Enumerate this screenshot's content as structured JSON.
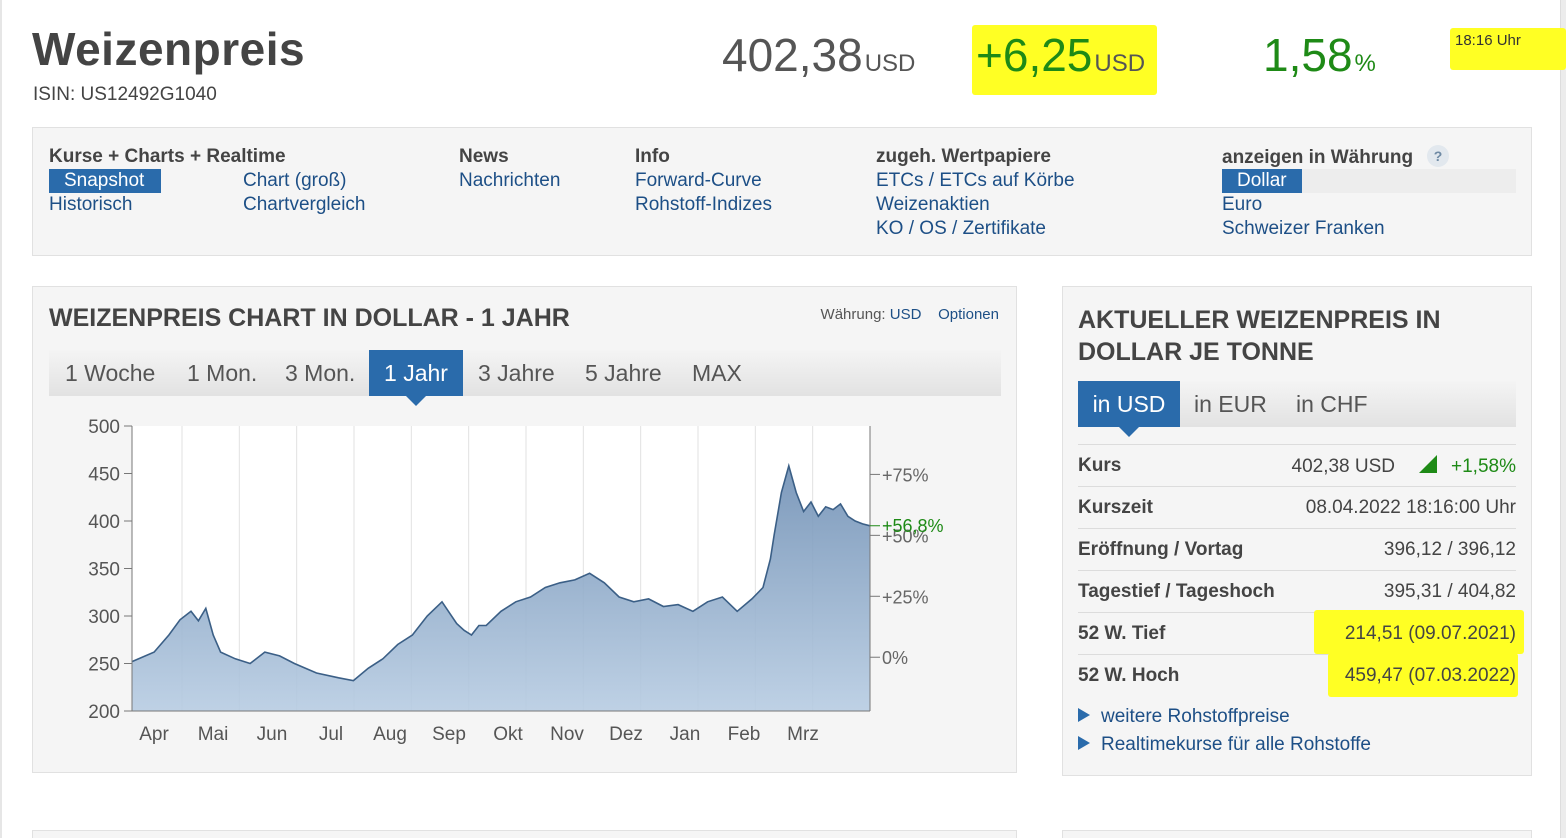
{
  "header": {
    "title": "Weizenpreis",
    "isin": "ISIN: US12492G1040",
    "price": "402,38",
    "price_unit": "USD",
    "change": "+6,25",
    "change_unit": "USD",
    "change_pct": "1,58",
    "pct_unit": "%",
    "time": "18:16 Uhr"
  },
  "nav": {
    "col1": {
      "heading": "Kurse + Charts + Realtime",
      "links": [
        "Snapshot",
        "Historisch",
        "Chart (groß)",
        "Chartvergleich"
      ]
    },
    "col2": {
      "heading": "News",
      "links": [
        "Nachrichten"
      ]
    },
    "col3": {
      "heading": "Info",
      "links": [
        "Forward-Curve",
        "Rohstoff-Indizes"
      ]
    },
    "col4": {
      "heading": "zugeh. Wertpapiere",
      "links": [
        "ETCs / ETCs auf Körbe",
        "Weizenaktien",
        "KO / OS / Zertifikate"
      ]
    },
    "col5": {
      "heading": "anzeigen in Währung",
      "help": "?",
      "links": [
        "Dollar",
        "Euro",
        "Schweizer Franken"
      ]
    }
  },
  "chart_panel": {
    "title": "WEIZENPREIS CHART IN DOLLAR - 1 JAHR",
    "currency_label": "Währung:",
    "currency_value": "USD",
    "options_label": "Optionen",
    "tabs": [
      "1 Woche",
      "1 Mon.",
      "3 Mon.",
      "1 Jahr",
      "3 Jahre",
      "5 Jahre",
      "MAX"
    ],
    "active_tab": "1 Jahr"
  },
  "chart_data": {
    "type": "area",
    "title": "WEIZENPREIS CHART IN DOLLAR - 1 JAHR",
    "xlabel": "",
    "ylabel": "",
    "ylim": [
      200,
      500
    ],
    "y_ticks": [
      "500",
      "450",
      "400",
      "350",
      "300",
      "250",
      "200"
    ],
    "x_ticks": [
      "Apr",
      "Mai",
      "Jun",
      "Jul",
      "Aug",
      "Sep",
      "Okt",
      "Nov",
      "Dez",
      "Jan",
      "Feb",
      "Mrz"
    ],
    "right_axis": {
      "ticks": [
        "+75%",
        "+50%",
        "+25%",
        "0%"
      ],
      "values": [
        75,
        50,
        25,
        0
      ],
      "base": 256.6,
      "current_label": "+56,8%"
    },
    "grid": true,
    "x": [
      0,
      0.03,
      0.05,
      0.065,
      0.08,
      0.09,
      0.1,
      0.11,
      0.12,
      0.14,
      0.16,
      0.18,
      0.2,
      0.22,
      0.25,
      0.28,
      0.3,
      0.32,
      0.34,
      0.36,
      0.38,
      0.4,
      0.42,
      0.44,
      0.45,
      0.46,
      0.47,
      0.48,
      0.5,
      0.52,
      0.54,
      0.56,
      0.58,
      0.6,
      0.62,
      0.64,
      0.66,
      0.68,
      0.7,
      0.72,
      0.74,
      0.76,
      0.78,
      0.8,
      0.82,
      0.84,
      0.855,
      0.865,
      0.87,
      0.88,
      0.89,
      0.9,
      0.91,
      0.92,
      0.93,
      0.94,
      0.95,
      0.96,
      0.97,
      0.98,
      0.99,
      1.0
    ],
    "series": [
      {
        "values": [
          252,
          262,
          280,
          296,
          305,
          295,
          308,
          280,
          262,
          255,
          250,
          262,
          258,
          250,
          240,
          235,
          232,
          245,
          255,
          270,
          280,
          300,
          315,
          292,
          285,
          280,
          290,
          290,
          305,
          315,
          320,
          330,
          335,
          338,
          345,
          335,
          320,
          315,
          318,
          310,
          312,
          305,
          315,
          320,
          305,
          318,
          330,
          360,
          385,
          430,
          458,
          430,
          410,
          420,
          405,
          415,
          412,
          418,
          405,
          400,
          397,
          395
        ]
      }
    ]
  },
  "price_panel": {
    "title": "AKTUELLER WEIZENPREIS IN DOLLAR JE TONNE",
    "tabs": [
      "in USD",
      "in EUR",
      "in CHF"
    ],
    "rows": [
      {
        "label": "Kurs",
        "value": "402,38 USD",
        "change": "+1,58%"
      },
      {
        "label": "Kurszeit",
        "value": "08.04.2022 18:16:00 Uhr"
      },
      {
        "label": "Eröffnung / Vortag",
        "value": "396,12 / 396,12"
      },
      {
        "label": "Tagestief / Tageshoch",
        "value": "395,31 / 404,82"
      },
      {
        "label": "52 W. Tief",
        "value": "214,51 (09.07.2021)"
      },
      {
        "label": "52 W. Hoch",
        "value": "459,47 (07.03.2022)"
      }
    ],
    "links": [
      "weitere Rohstoffpreise",
      "Realtimekurse für alle Rohstoffe"
    ]
  },
  "colors": {
    "accent": "#2a6bab",
    "link": "#1d4f86",
    "positive": "#1e8a16",
    "highlight": "#ffff24",
    "area_fill": "#8fa9c7",
    "area_line": "#3b5f86"
  }
}
